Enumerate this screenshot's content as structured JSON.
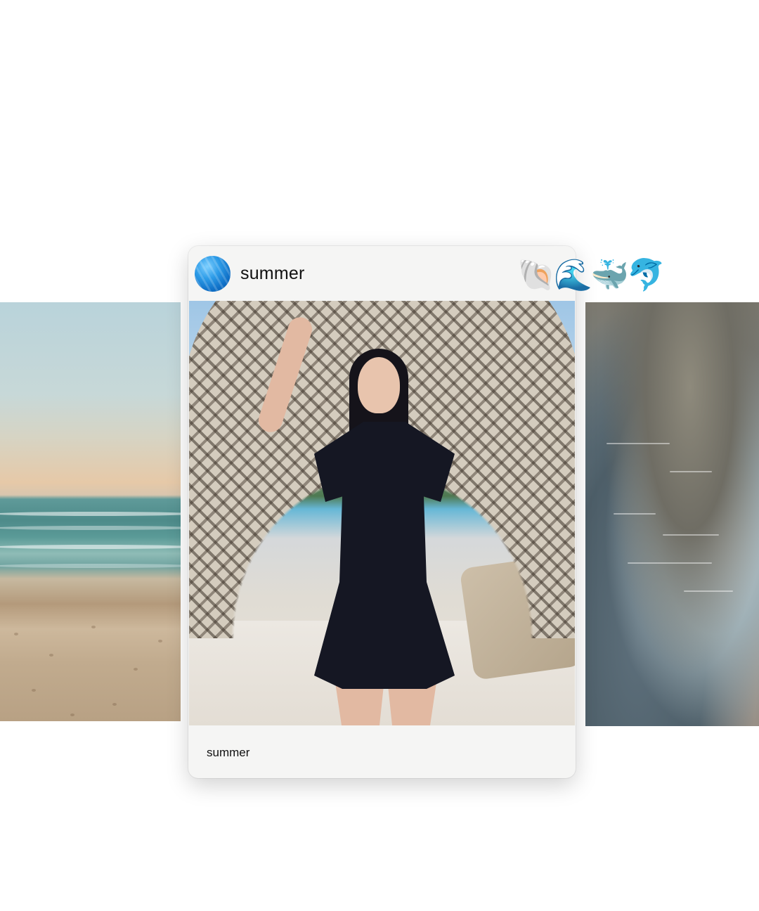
{
  "post": {
    "username": "summer",
    "caption": "summer",
    "emojis": [
      "🐚",
      "🌊",
      "🐳",
      "🐬"
    ]
  },
  "colors": {
    "card_background": "#f5f5f4",
    "page_background": "#ffffff",
    "avatar_blue": "#2d9ce8"
  },
  "images": {
    "left": "beach-shore-photo",
    "center": "woman-in-black-dress-cabana-photo",
    "right": "clear-water-rocks-photo"
  }
}
